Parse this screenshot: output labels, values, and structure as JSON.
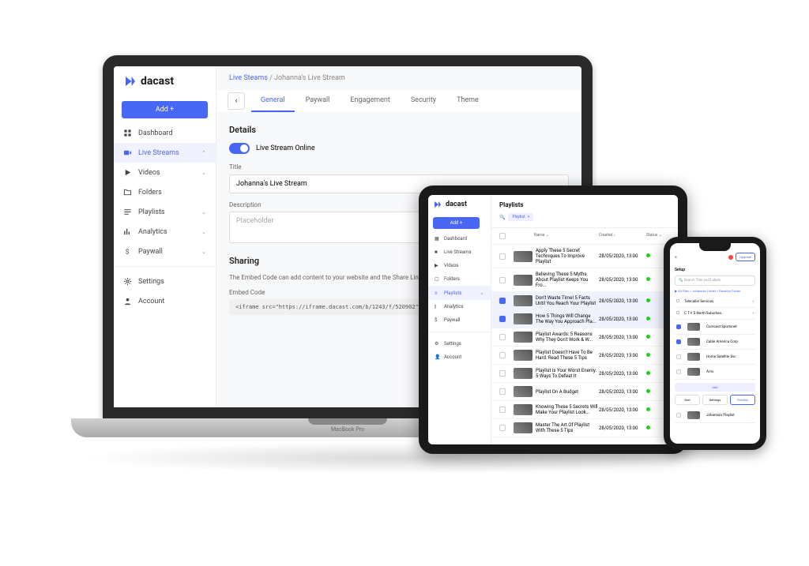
{
  "brand": "dacast",
  "laptop_brand": "MacBook Pro",
  "add_button": "Add +",
  "sidebar": {
    "items": [
      {
        "label": "Dashboard"
      },
      {
        "label": "Live Streams"
      },
      {
        "label": "Videos"
      },
      {
        "label": "Folders"
      },
      {
        "label": "Playlists"
      },
      {
        "label": "Analytics"
      },
      {
        "label": "Paywall"
      },
      {
        "label": "Settings"
      },
      {
        "label": "Account"
      }
    ]
  },
  "laptop": {
    "breadcrumb_parent": "Live Steams",
    "breadcrumb_sep": " / ",
    "breadcrumb_current": "Johanna's Live Stream",
    "tabs": [
      "General",
      "Paywall",
      "Engagement",
      "Security",
      "Theme"
    ],
    "details_title": "Details",
    "toggle_label": "Live Stream Online",
    "title_label": "Title",
    "title_value": "Johanna's Live Stream",
    "desc_label": "Description",
    "desc_placeholder": "Placeholder",
    "sharing_title": "Sharing",
    "sharing_desc": "The Embed Code can add content to your website and the Share Link ca",
    "embed_label": "Embed Code",
    "embed_value": "<iframe src=\"https://iframe.dacast.com/b/1243/f/520902\" width=\"576"
  },
  "tablet": {
    "page_title": "Playlists",
    "filter_chip": "Playlist",
    "columns": {
      "name": "Name",
      "created": "Created",
      "status": "Status"
    },
    "rows": [
      {
        "name": "Apply These 5 Secret Techniques To Improve Playlist",
        "date": "28/05/2020, 13:00"
      },
      {
        "name": "Believing These 5 Myths About Playlist Keeps You Fro...",
        "date": "28/05/2020, 13:00"
      },
      {
        "name": "Don't Waste Time! 5 Facts Until You Reach Your Playlist",
        "date": "28/05/2020, 13:00"
      },
      {
        "name": "How 5 Things Will Change The Way You Approach Pla...",
        "date": "28/05/2020, 13:00"
      },
      {
        "name": "Playlist Awards: 5 Reasons Why They Don't Work & W...",
        "date": "28/05/2020, 13:00"
      },
      {
        "name": "Playlist Doesn't Have To Be Hard. Read These 5 Tips",
        "date": "28/05/2020, 13:00"
      },
      {
        "name": "Playlist Is Your Worst Enemy. 5 Ways To Defeat It",
        "date": "28/05/2020, 13:00"
      },
      {
        "name": "Playlist On A Budget",
        "date": "28/05/2020, 13:00"
      },
      {
        "name": "Knowing These 5 Secrets Will Make Your Playlist Look...",
        "date": "28/05/2020, 13:00"
      },
      {
        "name": "Master The Art Of Playlist With These 5 Tips",
        "date": "28/05/2020, 13:00"
      }
    ]
  },
  "phone": {
    "upgrade": "Upgrade",
    "header": "Setup",
    "search_placeholder": "Search Title and Labels",
    "breadcrumb": "All Files > Johanna's Folder > Random Folder",
    "folders": [
      "Telecaller Services",
      "C T V S North Suburban..."
    ],
    "items": [
      "Comcast Sportsnet",
      "Cable America Corp",
      "Home Satellite Svc",
      "Arris"
    ],
    "add": "Add",
    "buttons": [
      "Sort",
      "Settings",
      "Preview"
    ],
    "footer_item": "Johanna's Playlist"
  }
}
